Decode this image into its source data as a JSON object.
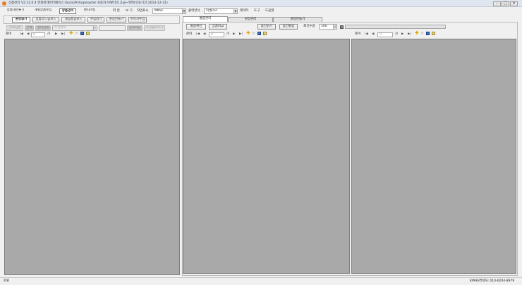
{
  "window": {
    "title": "상품관리 V2.12.0.4 연결된데이터베이스:(local)#shopmaster 사용자:이렇다의 고급~퓨퍼(유효기간:2014-12-31)",
    "controls": [
      "–",
      "□",
      "×"
    ]
  },
  "topbar": {
    "nav_buttons": [
      "상품대분류기",
      "개별상품수집",
      "상품관리",
      "벤치마킹"
    ],
    "menu": [
      "파 일",
      "보 기",
      "작업표시"
    ],
    "source_value": "MNVI",
    "sort_label": "출력양식",
    "sort_value": "이엘마스",
    "menu2": [
      "데이터",
      "도구",
      "도움말"
    ]
  },
  "left": {
    "toolbar": [
      "원장읽기",
      "상품코드업로드",
      "대상품업로드",
      "수입읽기",
      "원장만들기",
      "이미지수집"
    ],
    "filter_buttons": [
      "선택상품",
      "전체",
      "필터상세"
    ],
    "filter_placeholder": "조건항목",
    "filter_actions": [
      "결과저장",
      "조건불러오기"
    ],
    "nav": {
      "label": "준비",
      "position": "0",
      "total": "/0"
    }
  },
  "right": {
    "tabs": [
      "통합관리",
      "원장관리",
      "원장만들기"
    ],
    "actions": {
      "check": "통합확인",
      "compare": "상품비교",
      "read": "옵션읽기",
      "merge": "옵션통합",
      "max_label": "최건수량",
      "max_value": "100"
    },
    "nav1": {
      "label": "준비",
      "position": "0",
      "total": "/0"
    },
    "nav2": {
      "label": "준비",
      "position": "0",
      "total": "/0"
    }
  },
  "status": {
    "left": "완료",
    "right": "KMHS연락처: 010-6204-8979"
  }
}
